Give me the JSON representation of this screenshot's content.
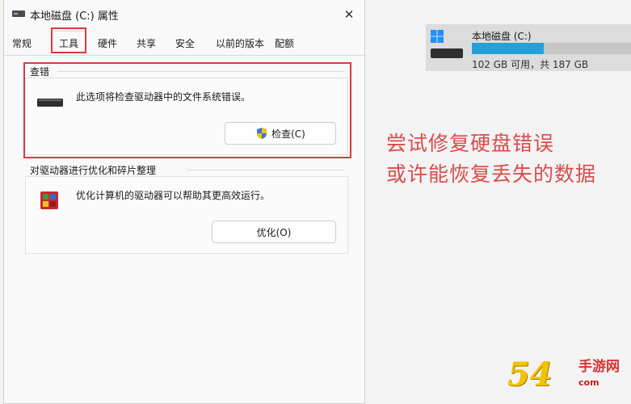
{
  "dialog": {
    "title": "本地磁盘 (C:) 属性",
    "close_label": "✕",
    "tabs": [
      "常规",
      "工具",
      "硬件",
      "共享",
      "安全",
      "以前的版本",
      "配额"
    ],
    "active_tab": "工具"
  },
  "check_section": {
    "title": "查错",
    "description": "此选项将检查驱动器中的文件系统错误。",
    "button_label": "检查(C)"
  },
  "optimize_section": {
    "title": "对驱动器进行优化和碎片整理",
    "description": "优化计算机的驱动器可以帮助其更高效运行。",
    "button_label": "优化(O)"
  },
  "drive": {
    "name": "本地磁盘 (C:)",
    "size_text": "102 GB 可用，共 187 GB",
    "used_fraction": 0.45
  },
  "annotation": {
    "line1": "尝试修复硬盘错误",
    "line2": "或许能恢复丢失的数据"
  },
  "watermark": {
    "number": "54",
    "text": "手游网",
    "sub": "com"
  },
  "colors": {
    "highlight": "#d93a3f",
    "drive_bar": "#26a0da",
    "annotation": "#d94c4c"
  }
}
